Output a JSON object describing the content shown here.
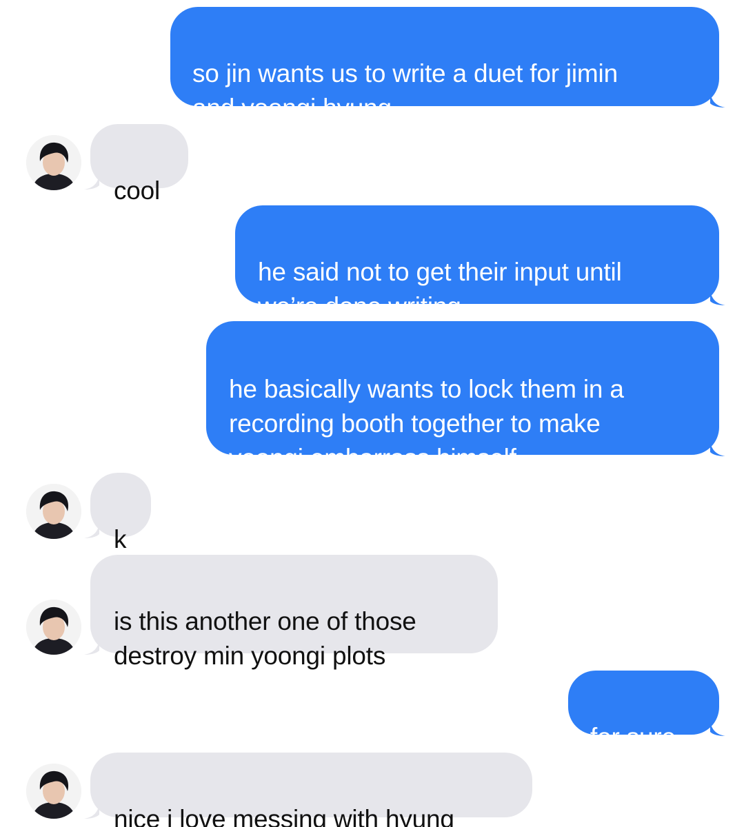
{
  "conversation": {
    "messages": [
      {
        "direction": "sent",
        "text": "so jin wants us to write a duet for jimin\nand yoongi hyung"
      },
      {
        "direction": "received",
        "text": "cool",
        "avatar": "contact-avatar"
      },
      {
        "direction": "sent",
        "text": "he said not to get their input until\nwe’re done writing"
      },
      {
        "direction": "sent",
        "text": "he basically wants to lock them in a\nrecording booth together to make\nyoongi embarrass himself"
      },
      {
        "direction": "received",
        "text": "k",
        "avatar": "contact-avatar"
      },
      {
        "direction": "received",
        "text": "is this another one of those\ndestroy min yoongi plots",
        "avatar": "contact-avatar"
      },
      {
        "direction": "sent",
        "text": "for sure"
      },
      {
        "direction": "received",
        "text": "nice i love messing with hyung",
        "avatar": "contact-avatar"
      }
    ]
  },
  "colors": {
    "sent_bubble": "#2e7ef6",
    "received_bubble": "#e6e6eb",
    "background": "#ffffff"
  }
}
